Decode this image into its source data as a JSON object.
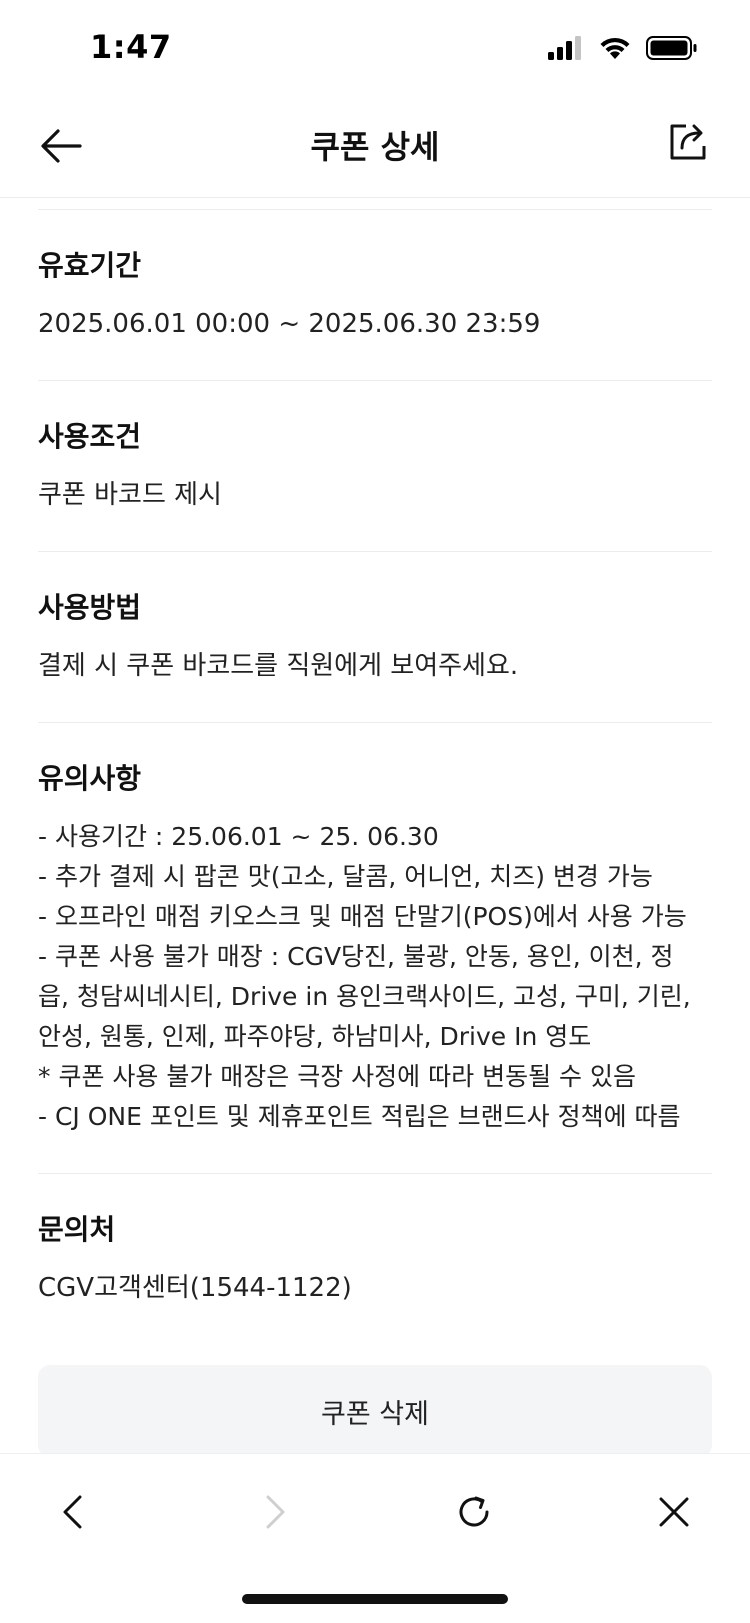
{
  "status_bar": {
    "time": "1:47",
    "icons": [
      "cellular-signal-icon",
      "wifi-icon",
      "battery-icon"
    ]
  },
  "navbar": {
    "back_icon": "arrow-left-icon",
    "title": "쿠폰 상세",
    "share_icon": "share-icon"
  },
  "sections": {
    "validity": {
      "title": "유효기간",
      "body": "2025.06.01 00:00 ~ 2025.06.30 23:59"
    },
    "condition": {
      "title": "사용조건",
      "body": "쿠폰 바코드 제시"
    },
    "method": {
      "title": "사용방법",
      "body": "결제 시 쿠폰 바코드를 직원에게 보여주세요."
    },
    "notes": {
      "title": "유의사항",
      "lines": [
        "- 사용기간 : 25.06.01 ~ 25. 06.30",
        "- 추가 결제 시 팝콘 맛(고소, 달콤, 어니언, 치즈) 변경 가능",
        "- 오프라인 매점 키오스크 및 매점 단말기(POS)에서 사용 가능",
        "- 쿠폰 사용 불가 매장 : CGV당진, 불광, 안동, 용인, 이천, 정",
        "읍, 청담씨네시티, Drive in 용인크랙사이드, 고성, 구미, 기린,",
        "안성, 원통, 인제, 파주야당, 하남미사, Drive In 영도",
        "* 쿠폰 사용 불가 매장은 극장 사정에 따라 변동될 수 있음",
        "- CJ ONE 포인트 및 제휴포인트 적립은 브랜드사 정책에 따름"
      ]
    },
    "contact": {
      "title": "문의처",
      "body": "CGV고객센터(1544-1122)"
    }
  },
  "delete_button": {
    "label": "쿠폰 삭제"
  },
  "toolbar": {
    "items": [
      "chevron-left-icon",
      "chevron-right-icon",
      "refresh-icon",
      "close-icon"
    ]
  }
}
